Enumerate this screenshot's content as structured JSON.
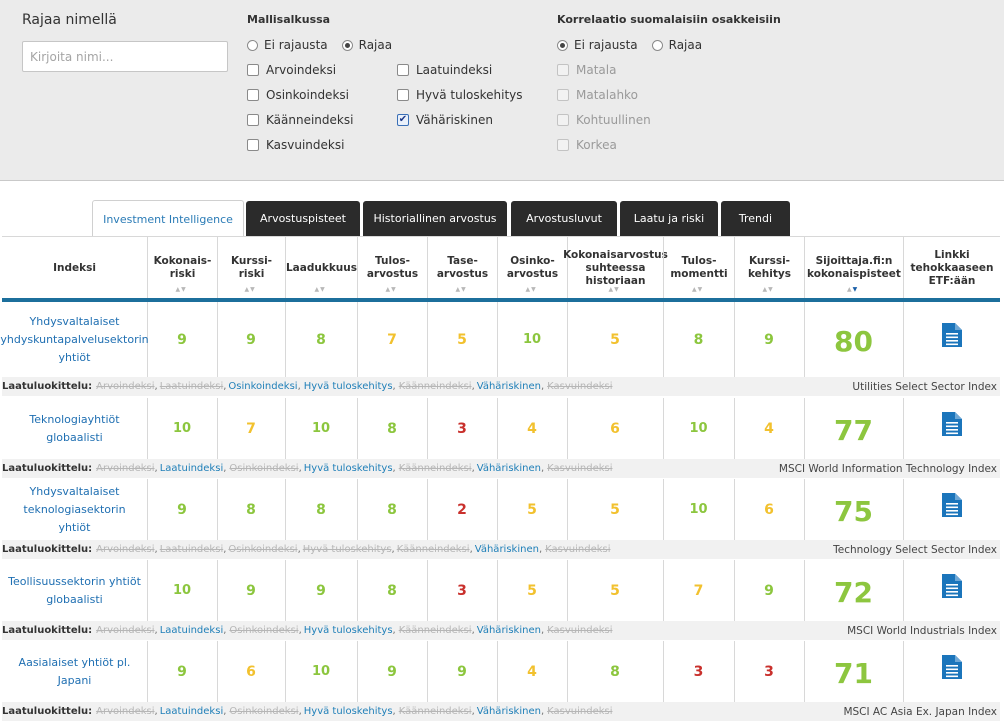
{
  "filters": {
    "name_title": "Rajaa nimellä",
    "name_placeholder": "Kirjoita nimi...",
    "portfolio": {
      "title": "Mallisalkussa",
      "radio_none": "Ei rajausta",
      "radio_limit": "Rajaa",
      "selected": "Rajaa",
      "col1": [
        {
          "label": "Arvoindeksi",
          "checked": false
        },
        {
          "label": "Osinkoindeksi",
          "checked": false
        },
        {
          "label": "Käänneindeksi",
          "checked": false
        },
        {
          "label": "Kasvuindeksi",
          "checked": false
        }
      ],
      "col2": [
        {
          "label": "Laatuindeksi",
          "checked": false
        },
        {
          "label": "Hyvä tuloskehitys",
          "checked": false
        },
        {
          "label": "Vähäriskinen",
          "checked": true
        }
      ]
    },
    "correlation": {
      "title": "Korrelaatio suomalaisiin osakkeisiin",
      "radio_none": "Ei rajausta",
      "radio_limit": "Rajaa",
      "selected": "Ei rajausta",
      "options": [
        "Matala",
        "Matalahko",
        "Kohtuullinen",
        "Korkea"
      ]
    }
  },
  "tabs": [
    {
      "label": "Investment Intelligence",
      "active": true
    },
    {
      "label": "Arvostuspisteet",
      "active": false
    },
    {
      "label": "Historiallinen arvostus",
      "active": false
    },
    {
      "label": "Arvostusluvut",
      "active": false
    },
    {
      "label": "Laatu ja riski",
      "active": false
    },
    {
      "label": "Trendi",
      "active": false
    }
  ],
  "columns": [
    {
      "lines": [
        "Indeksi"
      ],
      "sortable": false
    },
    {
      "lines": [
        "Kokonais-",
        "riski"
      ],
      "sortable": true
    },
    {
      "lines": [
        "Kurssi-",
        "riski"
      ],
      "sortable": true
    },
    {
      "lines": [
        "Laadukkuus"
      ],
      "sortable": true
    },
    {
      "lines": [
        "Tulos-",
        "arvostus"
      ],
      "sortable": true
    },
    {
      "lines": [
        "Tase-",
        "arvostus"
      ],
      "sortable": true
    },
    {
      "lines": [
        "Osinko-",
        "arvostus"
      ],
      "sortable": true
    },
    {
      "lines": [
        "Kokonaisarvostus",
        "suhteessa",
        "historiaan"
      ],
      "sortable": true
    },
    {
      "lines": [
        "Tulos-",
        "momentti"
      ],
      "sortable": true
    },
    {
      "lines": [
        "Kurssi-",
        "kehitys"
      ],
      "sortable": true
    },
    {
      "lines": [
        "Sijoittaja.fi:n",
        "kokonaispisteet"
      ],
      "sortable": true,
      "active": true
    },
    {
      "lines": [
        "Linkki",
        "tehokkaaseen",
        "ETF:ään"
      ],
      "sortable": false
    }
  ],
  "quality_label": "Laatuluokittelu:",
  "score_colors": {
    "high": "#8cc63e",
    "mid": "#f2c12e",
    "low": "#c9302c"
  },
  "rows": [
    {
      "name": "Yhdysvaltalaiset yhdyskuntapalvelusektorin yhtiöt",
      "scores": [
        9,
        9,
        8,
        7,
        5,
        10,
        5,
        8,
        9
      ],
      "total": "80",
      "benchmark": "Utilities Select Sector Index",
      "quality": [
        {
          "label": "Arvoindeksi",
          "ok": false
        },
        {
          "label": "Laatuindeksi",
          "ok": false
        },
        {
          "label": "Osinkoindeksi",
          "ok": true
        },
        {
          "label": "Hyvä tuloskehitys",
          "ok": true
        },
        {
          "label": "Käänneindeksi",
          "ok": false
        },
        {
          "label": "Vähäriskinen",
          "ok": true
        },
        {
          "label": "Kasvuindeksi",
          "ok": false
        }
      ]
    },
    {
      "name": "Teknologiayhtiöt globaalisti",
      "scores": [
        10,
        7,
        10,
        8,
        3,
        4,
        6,
        10,
        4
      ],
      "total": "77",
      "benchmark": "MSCI World Information Technology Index",
      "quality": [
        {
          "label": "Arvoindeksi",
          "ok": false
        },
        {
          "label": "Laatuindeksi",
          "ok": true
        },
        {
          "label": "Osinkoindeksi",
          "ok": false
        },
        {
          "label": "Hyvä tuloskehitys",
          "ok": true
        },
        {
          "label": "Käänneindeksi",
          "ok": false
        },
        {
          "label": "Vähäriskinen",
          "ok": true
        },
        {
          "label": "Kasvuindeksi",
          "ok": false
        }
      ]
    },
    {
      "name": "Yhdysvaltalaiset teknologiasektorin yhtiöt",
      "scores": [
        9,
        8,
        8,
        8,
        2,
        5,
        5,
        10,
        6
      ],
      "total": "75",
      "benchmark": "Technology Select Sector Index",
      "quality": [
        {
          "label": "Arvoindeksi",
          "ok": false
        },
        {
          "label": "Laatuindeksi",
          "ok": false
        },
        {
          "label": "Osinkoindeksi",
          "ok": false
        },
        {
          "label": "Hyvä tuloskehitys",
          "ok": false
        },
        {
          "label": "Käänneindeksi",
          "ok": false
        },
        {
          "label": "Vähäriskinen",
          "ok": true
        },
        {
          "label": "Kasvuindeksi",
          "ok": false
        }
      ]
    },
    {
      "name": "Teollisuussektorin yhtiöt globaalisti",
      "scores": [
        10,
        9,
        9,
        8,
        3,
        5,
        5,
        7,
        9
      ],
      "total": "72",
      "benchmark": "MSCI World Industrials Index",
      "quality": [
        {
          "label": "Arvoindeksi",
          "ok": false
        },
        {
          "label": "Laatuindeksi",
          "ok": true
        },
        {
          "label": "Osinkoindeksi",
          "ok": false
        },
        {
          "label": "Hyvä tuloskehitys",
          "ok": true
        },
        {
          "label": "Käänneindeksi",
          "ok": false
        },
        {
          "label": "Vähäriskinen",
          "ok": true
        },
        {
          "label": "Kasvuindeksi",
          "ok": false
        }
      ]
    },
    {
      "name": "Aasialaiset yhtiöt pl. Japani",
      "scores": [
        9,
        6,
        10,
        9,
        9,
        4,
        8,
        3,
        3
      ],
      "total": "71",
      "benchmark": "MSCI AC Asia Ex. Japan Index",
      "quality": [
        {
          "label": "Arvoindeksi",
          "ok": false
        },
        {
          "label": "Laatuindeksi",
          "ok": true
        },
        {
          "label": "Osinkoindeksi",
          "ok": false
        },
        {
          "label": "Hyvä tuloskehitys",
          "ok": true
        },
        {
          "label": "Käänneindeksi",
          "ok": false
        },
        {
          "label": "Vähäriskinen",
          "ok": true
        },
        {
          "label": "Kasvuindeksi",
          "ok": false
        }
      ]
    }
  ]
}
